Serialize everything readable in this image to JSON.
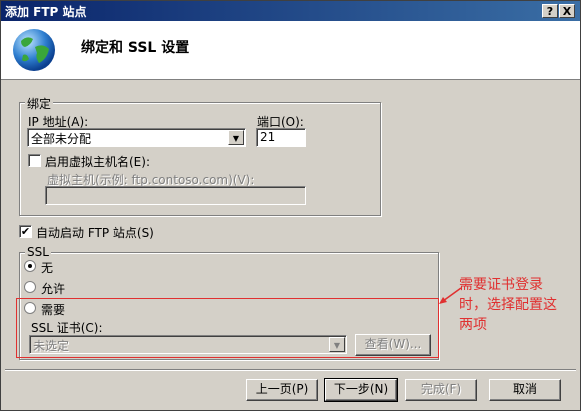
{
  "window": {
    "title": "添加 FTP 站点",
    "help_label": "?",
    "close_label": "X"
  },
  "header": {
    "title": "绑定和 SSL 设置"
  },
  "binding": {
    "legend": "绑定",
    "ip_label": "IP 地址(A):",
    "ip_value": "全部未分配",
    "port_label": "端口(O):",
    "port_value": "21",
    "vhost_checkbox_label": "启用虚拟主机名(E):",
    "vhost_checked": false,
    "vhost_field_label": "虚拟主机(示例: ftp.contoso.com)(V):",
    "vhost_value": ""
  },
  "autostart": {
    "label": "自动启动 FTP 站点(S)",
    "checked": true
  },
  "ssl": {
    "legend": "SSL",
    "options": [
      "无",
      "允许",
      "需要"
    ],
    "selected": "无",
    "cert_label": "SSL 证书(C):",
    "cert_value": "未选定",
    "view_button": "查看(W)..."
  },
  "annotation": {
    "text_line1": "需要证书登录",
    "text_line2": "时，选择配置这",
    "text_line3": "两项",
    "color": "#e03030"
  },
  "footer": {
    "prev_button": "上一页(P)",
    "next_button": "下一步(N)",
    "finish_button": "完成(F)",
    "cancel_button": "取消"
  }
}
